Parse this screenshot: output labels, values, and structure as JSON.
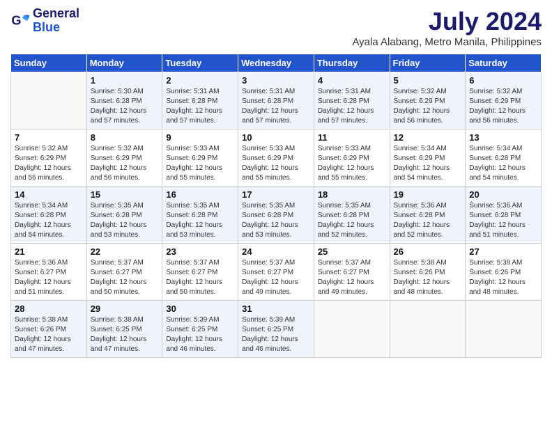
{
  "header": {
    "logo_line1": "General",
    "logo_line2": "Blue",
    "month": "July 2024",
    "location": "Ayala Alabang, Metro Manila, Philippines"
  },
  "weekdays": [
    "Sunday",
    "Monday",
    "Tuesday",
    "Wednesday",
    "Thursday",
    "Friday",
    "Saturday"
  ],
  "weeks": [
    [
      {
        "day": "",
        "info": ""
      },
      {
        "day": "1",
        "info": "Sunrise: 5:30 AM\nSunset: 6:28 PM\nDaylight: 12 hours\nand 57 minutes."
      },
      {
        "day": "2",
        "info": "Sunrise: 5:31 AM\nSunset: 6:28 PM\nDaylight: 12 hours\nand 57 minutes."
      },
      {
        "day": "3",
        "info": "Sunrise: 5:31 AM\nSunset: 6:28 PM\nDaylight: 12 hours\nand 57 minutes."
      },
      {
        "day": "4",
        "info": "Sunrise: 5:31 AM\nSunset: 6:28 PM\nDaylight: 12 hours\nand 57 minutes."
      },
      {
        "day": "5",
        "info": "Sunrise: 5:32 AM\nSunset: 6:29 PM\nDaylight: 12 hours\nand 56 minutes."
      },
      {
        "day": "6",
        "info": "Sunrise: 5:32 AM\nSunset: 6:29 PM\nDaylight: 12 hours\nand 56 minutes."
      }
    ],
    [
      {
        "day": "7",
        "info": "Sunrise: 5:32 AM\nSunset: 6:29 PM\nDaylight: 12 hours\nand 56 minutes."
      },
      {
        "day": "8",
        "info": "Sunrise: 5:32 AM\nSunset: 6:29 PM\nDaylight: 12 hours\nand 56 minutes."
      },
      {
        "day": "9",
        "info": "Sunrise: 5:33 AM\nSunset: 6:29 PM\nDaylight: 12 hours\nand 55 minutes."
      },
      {
        "day": "10",
        "info": "Sunrise: 5:33 AM\nSunset: 6:29 PM\nDaylight: 12 hours\nand 55 minutes."
      },
      {
        "day": "11",
        "info": "Sunrise: 5:33 AM\nSunset: 6:29 PM\nDaylight: 12 hours\nand 55 minutes."
      },
      {
        "day": "12",
        "info": "Sunrise: 5:34 AM\nSunset: 6:29 PM\nDaylight: 12 hours\nand 54 minutes."
      },
      {
        "day": "13",
        "info": "Sunrise: 5:34 AM\nSunset: 6:28 PM\nDaylight: 12 hours\nand 54 minutes."
      }
    ],
    [
      {
        "day": "14",
        "info": "Sunrise: 5:34 AM\nSunset: 6:28 PM\nDaylight: 12 hours\nand 54 minutes."
      },
      {
        "day": "15",
        "info": "Sunrise: 5:35 AM\nSunset: 6:28 PM\nDaylight: 12 hours\nand 53 minutes."
      },
      {
        "day": "16",
        "info": "Sunrise: 5:35 AM\nSunset: 6:28 PM\nDaylight: 12 hours\nand 53 minutes."
      },
      {
        "day": "17",
        "info": "Sunrise: 5:35 AM\nSunset: 6:28 PM\nDaylight: 12 hours\nand 53 minutes."
      },
      {
        "day": "18",
        "info": "Sunrise: 5:35 AM\nSunset: 6:28 PM\nDaylight: 12 hours\nand 52 minutes."
      },
      {
        "day": "19",
        "info": "Sunrise: 5:36 AM\nSunset: 6:28 PM\nDaylight: 12 hours\nand 52 minutes."
      },
      {
        "day": "20",
        "info": "Sunrise: 5:36 AM\nSunset: 6:28 PM\nDaylight: 12 hours\nand 51 minutes."
      }
    ],
    [
      {
        "day": "21",
        "info": "Sunrise: 5:36 AM\nSunset: 6:27 PM\nDaylight: 12 hours\nand 51 minutes."
      },
      {
        "day": "22",
        "info": "Sunrise: 5:37 AM\nSunset: 6:27 PM\nDaylight: 12 hours\nand 50 minutes."
      },
      {
        "day": "23",
        "info": "Sunrise: 5:37 AM\nSunset: 6:27 PM\nDaylight: 12 hours\nand 50 minutes."
      },
      {
        "day": "24",
        "info": "Sunrise: 5:37 AM\nSunset: 6:27 PM\nDaylight: 12 hours\nand 49 minutes."
      },
      {
        "day": "25",
        "info": "Sunrise: 5:37 AM\nSunset: 6:27 PM\nDaylight: 12 hours\nand 49 minutes."
      },
      {
        "day": "26",
        "info": "Sunrise: 5:38 AM\nSunset: 6:26 PM\nDaylight: 12 hours\nand 48 minutes."
      },
      {
        "day": "27",
        "info": "Sunrise: 5:38 AM\nSunset: 6:26 PM\nDaylight: 12 hours\nand 48 minutes."
      }
    ],
    [
      {
        "day": "28",
        "info": "Sunrise: 5:38 AM\nSunset: 6:26 PM\nDaylight: 12 hours\nand 47 minutes."
      },
      {
        "day": "29",
        "info": "Sunrise: 5:38 AM\nSunset: 6:25 PM\nDaylight: 12 hours\nand 47 minutes."
      },
      {
        "day": "30",
        "info": "Sunrise: 5:39 AM\nSunset: 6:25 PM\nDaylight: 12 hours\nand 46 minutes."
      },
      {
        "day": "31",
        "info": "Sunrise: 5:39 AM\nSunset: 6:25 PM\nDaylight: 12 hours\nand 46 minutes."
      },
      {
        "day": "",
        "info": ""
      },
      {
        "day": "",
        "info": ""
      },
      {
        "day": "",
        "info": ""
      }
    ]
  ]
}
